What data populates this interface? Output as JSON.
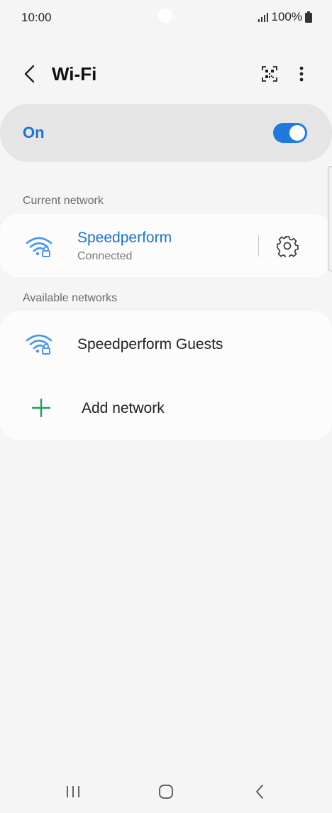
{
  "status_bar": {
    "time": "10:00",
    "battery": "100%",
    "icons": [
      "signal-icon",
      "battery-icon"
    ]
  },
  "header": {
    "title": "Wi-Fi",
    "icons": [
      "back-arrow-icon",
      "qr-code-icon",
      "more-options-icon"
    ]
  },
  "wifi_toggle": {
    "label": "On",
    "enabled": true,
    "accent_color": "#1a73d6"
  },
  "current_network": {
    "section_label": "Current network",
    "name": "Speedperform",
    "status": "Connected",
    "icon": "wifi-lock-icon",
    "settings_icon": "gear-icon"
  },
  "available_networks": {
    "section_label": "Available networks",
    "items": [
      {
        "name": "Speedperform Guests",
        "icon": "wifi-lock-icon"
      }
    ],
    "add_label": "Add network",
    "add_icon": "plus-icon",
    "add_color": "#1aa35a"
  },
  "nav_bar": {
    "icons": [
      "recent-apps-icon",
      "home-icon",
      "back-icon"
    ]
  }
}
